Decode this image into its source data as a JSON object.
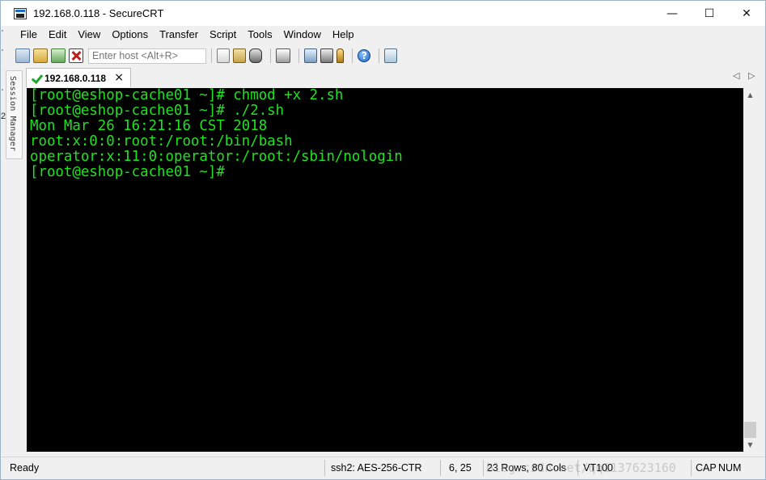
{
  "window": {
    "title": "192.168.0.118 - SecureCRT",
    "controls": {
      "minimize": "—",
      "maximize": "☐",
      "close": "✕"
    }
  },
  "menu": {
    "items": [
      "File",
      "Edit",
      "View",
      "Options",
      "Transfer",
      "Script",
      "Tools",
      "Window",
      "Help"
    ]
  },
  "toolbar": {
    "host_placeholder": "Enter host <Alt+R>",
    "icons": [
      "connect-icon",
      "quick-connect-icon",
      "reconnect-icon",
      "disconnect-icon",
      "copy-icon",
      "paste-icon",
      "find-icon",
      "print-icon",
      "session-options-icon",
      "global-options-icon",
      "keymap-icon",
      "help-icon",
      "script-icon"
    ]
  },
  "side": {
    "session_manager_label": "Session Manager",
    "gutter_number": "2"
  },
  "tabs": {
    "active_label": "192.168.0.118",
    "close_glyph": "×",
    "nav_left": "◁",
    "nav_right": "▷"
  },
  "terminal": {
    "lines": [
      "[root@eshop-cache01 ~]# chmod +x 2.sh",
      "[root@eshop-cache01 ~]# ./2.sh",
      "Mon Mar 26 16:21:16 CST 2018",
      "root:x:0:0:root:/root:/bin/bash",
      "operator:x:11:0:operator:/root:/sbin/nologin",
      "[root@eshop-cache01 ~]#"
    ],
    "fg_color": "#1ee31e",
    "bg_color": "#000000"
  },
  "scrollbar": {
    "up_glyph": "▲",
    "down_glyph": "▼"
  },
  "status": {
    "ready": "Ready",
    "cipher": "ssh2: AES-256-CTR",
    "cursor_pos": "6,  25",
    "size": "23 Rows, 80 Cols",
    "terminal_type": "VT100",
    "caps": "CAP",
    "num": "NUM",
    "watermark": "blog.csdn.net/qq1137623160"
  }
}
